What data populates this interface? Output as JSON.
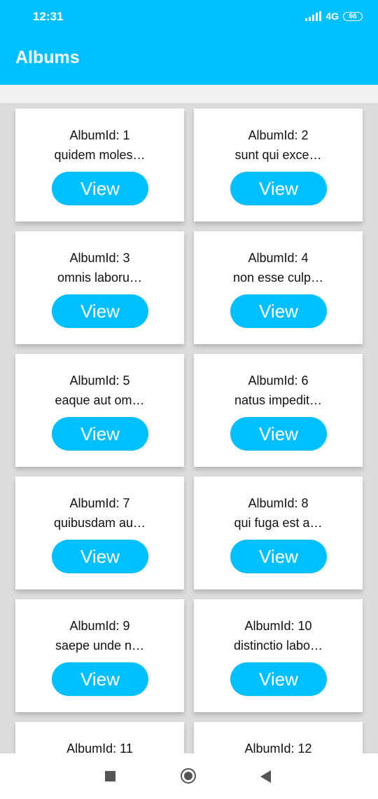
{
  "status_bar": {
    "time": "12:31",
    "network": "4G",
    "battery": "66"
  },
  "app_bar": {
    "title": "Albums"
  },
  "cards": [
    {
      "id_label": "AlbumId: 1",
      "title": "quidem moles…",
      "button": "View"
    },
    {
      "id_label": "AlbumId: 2",
      "title": "sunt qui exce…",
      "button": "View"
    },
    {
      "id_label": "AlbumId: 3",
      "title": "omnis laboru…",
      "button": "View"
    },
    {
      "id_label": "AlbumId: 4",
      "title": "non esse culp…",
      "button": "View"
    },
    {
      "id_label": "AlbumId: 5",
      "title": "eaque aut om…",
      "button": "View"
    },
    {
      "id_label": "AlbumId: 6",
      "title": "natus impedit…",
      "button": "View"
    },
    {
      "id_label": "AlbumId: 7",
      "title": "quibusdam au…",
      "button": "View"
    },
    {
      "id_label": "AlbumId: 8",
      "title": "qui fuga est a…",
      "button": "View"
    },
    {
      "id_label": "AlbumId: 9",
      "title": "saepe unde n…",
      "button": "View"
    },
    {
      "id_label": "AlbumId: 10",
      "title": "distinctio labo…",
      "button": "View"
    },
    {
      "id_label": "AlbumId: 11"
    },
    {
      "id_label": "AlbumId: 12"
    }
  ],
  "nav_bar": {
    "icons": [
      "recents-square-icon",
      "home-circle-icon",
      "back-triangle-icon"
    ]
  },
  "colors": {
    "accent": "#00bfff",
    "card_background": "#ffffff",
    "list_background": "#dcdcdc"
  }
}
